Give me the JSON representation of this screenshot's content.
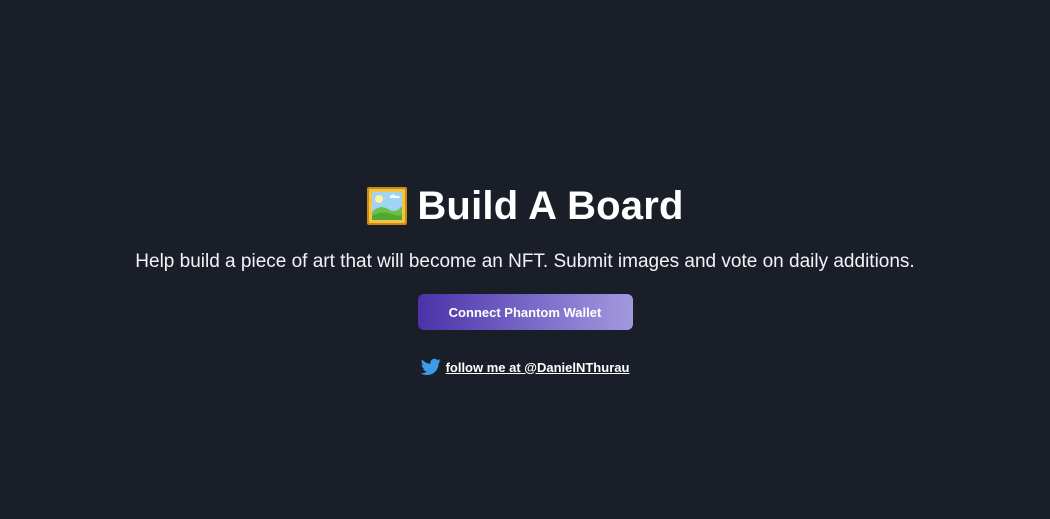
{
  "header": {
    "title_icon": "framed-picture-icon",
    "title": "Build A Board",
    "subtitle": "Help build a piece of art that will become an NFT. Submit images and vote on daily additions."
  },
  "actions": {
    "connect_label": "Connect Phantom Wallet"
  },
  "footer": {
    "twitter_icon": "twitter-bird-icon",
    "twitter_text": "follow me at @DanielNThurau"
  },
  "colors": {
    "background": "#1a1e28",
    "button_gradient_start": "#4a33a8",
    "button_gradient_end": "#a399dd",
    "twitter_blue": "#3b9be8"
  }
}
